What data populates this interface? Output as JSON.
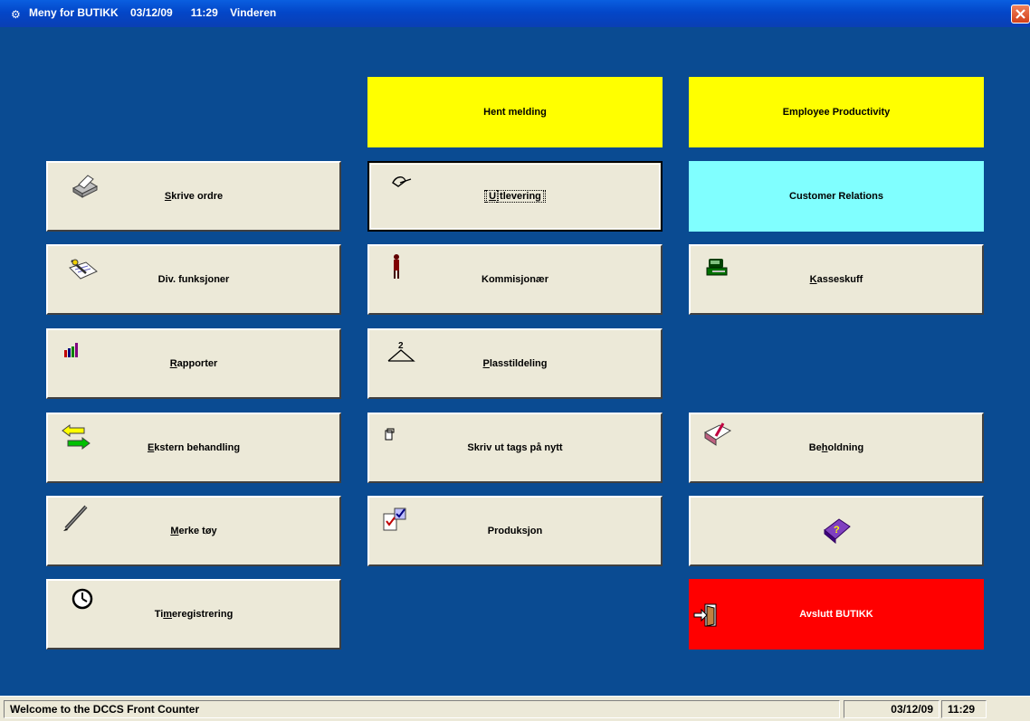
{
  "window": {
    "title": "Meny for BUTIKK    03/12/09      11:29    Vinderen"
  },
  "buttons": {
    "hent_melding": "Hent melding",
    "employee_productivity": "Employee Productivity",
    "skrive_ordre": {
      "ul": "S",
      "rest": "krive ordre"
    },
    "utlevering": {
      "ul": "U",
      "rest": "tlevering"
    },
    "customer_relations": "Customer Relations",
    "div_funksjoner": "Div. funksjoner",
    "kommisjonaer": "Kommisjonær",
    "kasseskuff": {
      "ul": "K",
      "rest": "asseskuff"
    },
    "rapporter": {
      "ul": "R",
      "rest": "apporter"
    },
    "plasstildeling": {
      "ul": "P",
      "rest": "lasstildeling"
    },
    "ekstern_behandling": {
      "ul": "E",
      "rest": "kstern behandling"
    },
    "skriv_ut_tags": "Skriv ut tags på nytt",
    "beholdning": {
      "pre": "Be",
      "ul": "h",
      "rest": "oldning"
    },
    "merke_toy": {
      "ul": "M",
      "rest": "erke tøy"
    },
    "produksjon": "Produksjon",
    "timeregistrering": {
      "pre": "Ti",
      "ul": "m",
      "rest": "eregistrering"
    },
    "avslutt": "Avslutt BUTIKK"
  },
  "status": {
    "message": "Welcome to the DCCS Front Counter",
    "date": "03/12/09",
    "time": "11:29"
  },
  "colors": {
    "background": "#0a4b92",
    "yellow": "#ffff00",
    "cyan": "#80ffff",
    "red": "#ff0000"
  }
}
